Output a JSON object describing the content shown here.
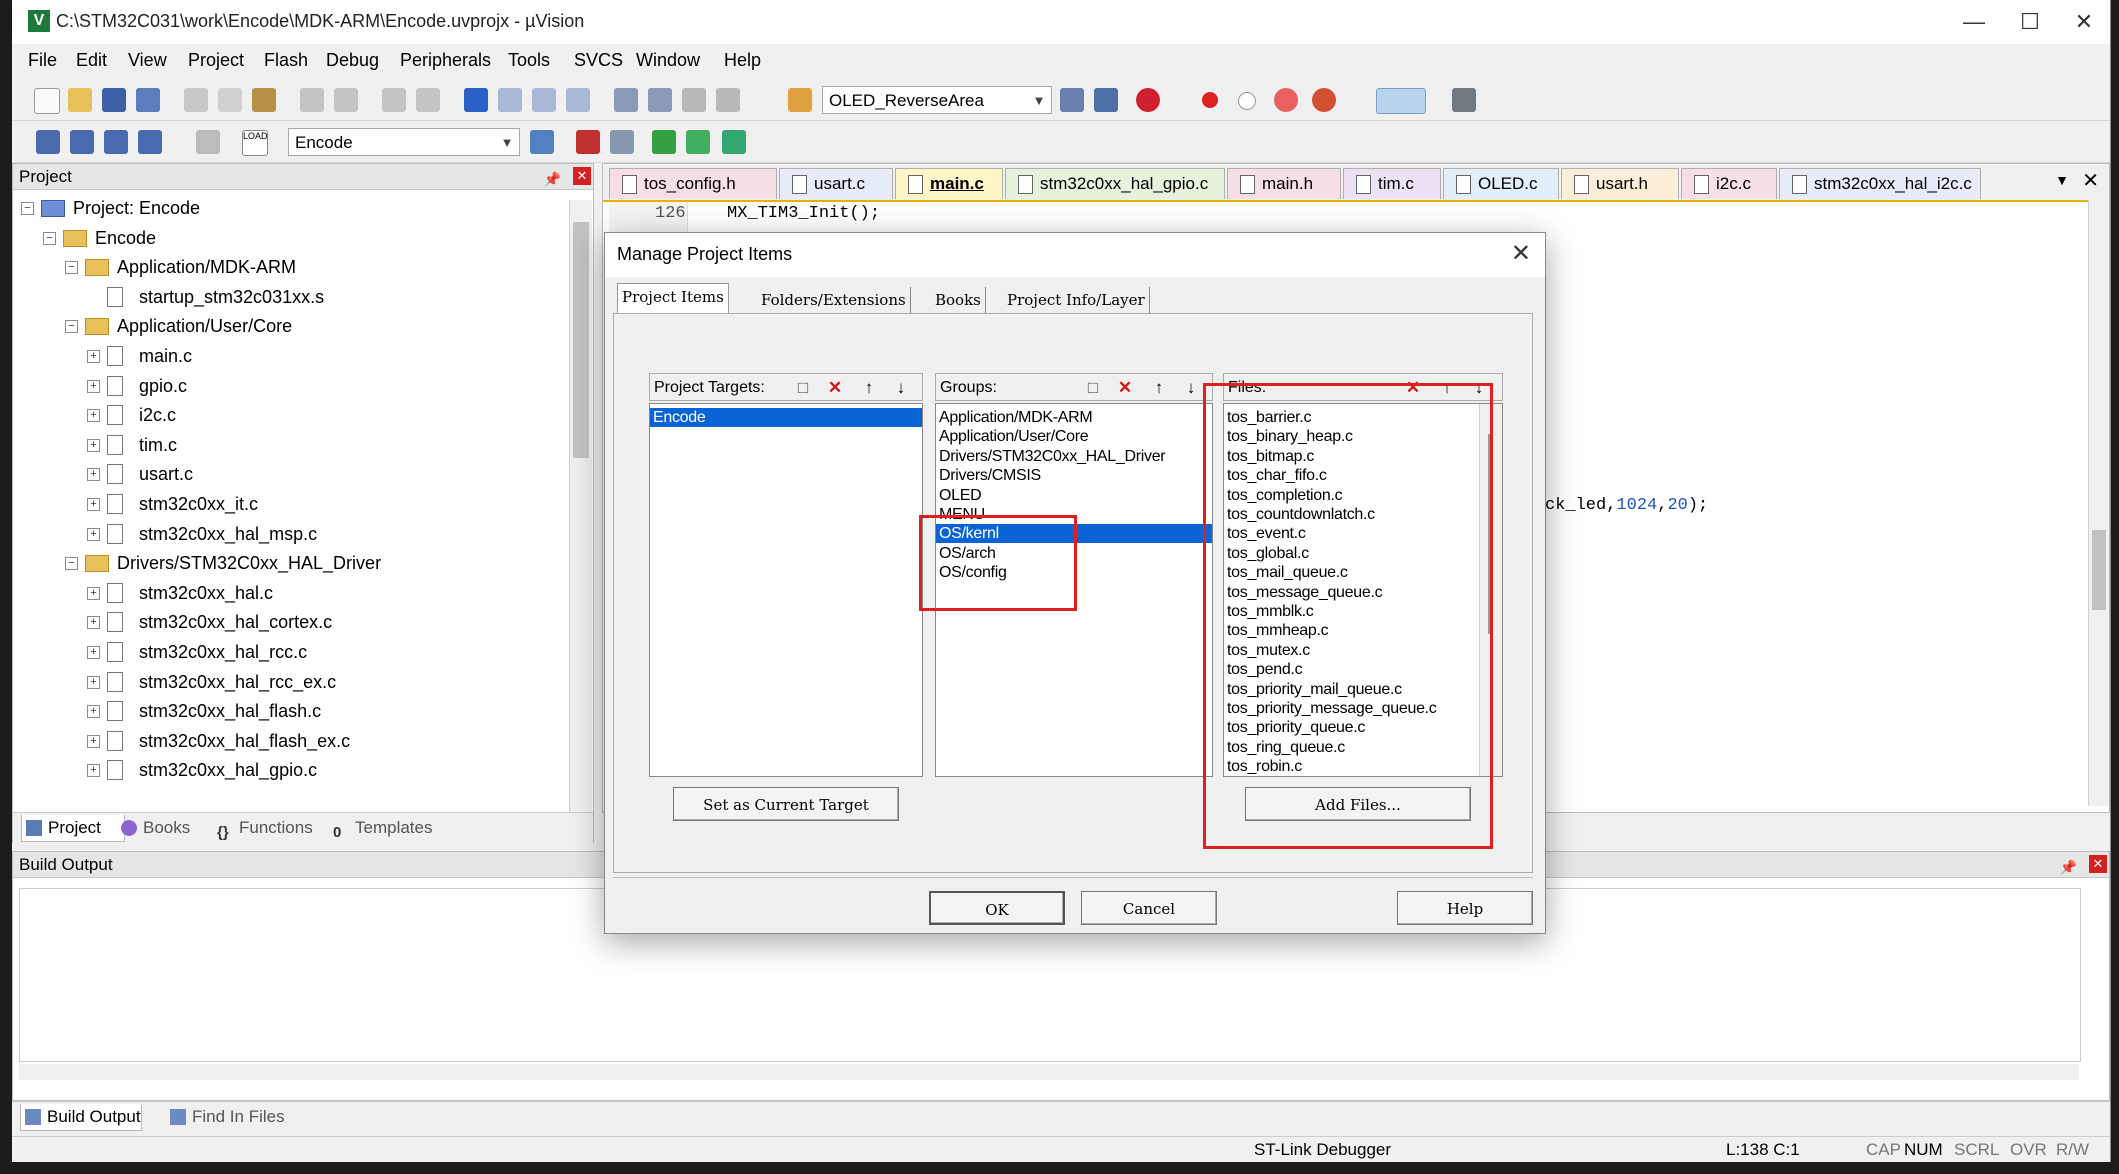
{
  "window": {
    "title": "C:\\STM32C031\\work\\Encode\\MDK-ARM\\Encode.uvprojx - µVision",
    "app_icon": "V"
  },
  "menu": [
    "File",
    "Edit",
    "View",
    "Project",
    "Flash",
    "Debug",
    "Peripherals",
    "Tools",
    "SVCS",
    "Window",
    "Help"
  ],
  "toolbar": {
    "search_combo": "OLED_ReverseArea",
    "target_combo": "Encode",
    "load_label": "LOAD"
  },
  "project_pane": {
    "title": "Project",
    "tree": [
      {
        "label": "Project: Encode",
        "level": 0,
        "kind": "project",
        "exp": "−"
      },
      {
        "label": "Encode",
        "level": 1,
        "kind": "target",
        "exp": "−"
      },
      {
        "label": "Application/MDK-ARM",
        "level": 2,
        "kind": "folder",
        "exp": "−"
      },
      {
        "label": "startup_stm32c031xx.s",
        "level": 3,
        "kind": "file",
        "exp": ""
      },
      {
        "label": "Application/User/Core",
        "level": 2,
        "kind": "folder",
        "exp": "−"
      },
      {
        "label": "main.c",
        "level": 3,
        "kind": "file",
        "exp": "+"
      },
      {
        "label": "gpio.c",
        "level": 3,
        "kind": "file",
        "exp": "+"
      },
      {
        "label": "i2c.c",
        "level": 3,
        "kind": "file",
        "exp": "+"
      },
      {
        "label": "tim.c",
        "level": 3,
        "kind": "file",
        "exp": "+"
      },
      {
        "label": "usart.c",
        "level": 3,
        "kind": "file",
        "exp": "+"
      },
      {
        "label": "stm32c0xx_it.c",
        "level": 3,
        "kind": "file",
        "exp": "+"
      },
      {
        "label": "stm32c0xx_hal_msp.c",
        "level": 3,
        "kind": "file",
        "exp": "+"
      },
      {
        "label": "Drivers/STM32C0xx_HAL_Driver",
        "level": 2,
        "kind": "folder",
        "exp": "−"
      },
      {
        "label": "stm32c0xx_hal.c",
        "level": 3,
        "kind": "file",
        "exp": "+"
      },
      {
        "label": "stm32c0xx_hal_cortex.c",
        "level": 3,
        "kind": "file",
        "exp": "+"
      },
      {
        "label": "stm32c0xx_hal_rcc.c",
        "level": 3,
        "kind": "file",
        "exp": "+"
      },
      {
        "label": "stm32c0xx_hal_rcc_ex.c",
        "level": 3,
        "kind": "file",
        "exp": "+"
      },
      {
        "label": "stm32c0xx_hal_flash.c",
        "level": 3,
        "kind": "file",
        "exp": "+"
      },
      {
        "label": "stm32c0xx_hal_flash_ex.c",
        "level": 3,
        "kind": "file",
        "exp": "+"
      },
      {
        "label": "stm32c0xx_hal_gpio.c",
        "level": 3,
        "kind": "file",
        "exp": "+"
      }
    ],
    "tabs": [
      "Project",
      "Books",
      "Functions",
      "Templates"
    ]
  },
  "editor": {
    "tabs": [
      {
        "label": "tos_config.h",
        "color": "#f6dfe6",
        "active": false
      },
      {
        "label": "usart.c",
        "color": "#e6ecf8",
        "active": false
      },
      {
        "label": "main.c",
        "color": "#fff6c8",
        "active": true
      },
      {
        "label": "stm32c0xx_hal_gpio.c",
        "color": "#e5f2dc",
        "active": false
      },
      {
        "label": "main.h",
        "color": "#f6dfe6",
        "active": false
      },
      {
        "label": "tim.c",
        "color": "#ece2f4",
        "active": false
      },
      {
        "label": "OLED.c",
        "color": "#e2eef8",
        "active": false
      },
      {
        "label": "usart.h",
        "color": "#fbeed8",
        "active": false
      },
      {
        "label": "i2c.c",
        "color": "#f6dfe6",
        "active": false
      },
      {
        "label": "stm32c0xx_hal_i2c.c",
        "color": "#e6ecf8",
        "active": false
      }
    ],
    "line_number": "126",
    "line_code": "MX_TIM3_Init();",
    "right_fragment_a": "ck_led,",
    "right_fragment_num1": "1024",
    "right_fragment_comma": ",",
    "right_fragment_num2": "20",
    "right_fragment_end": ");"
  },
  "build_output": {
    "title": "Build Output",
    "tabs": [
      "Build Output",
      "Find In Files"
    ]
  },
  "statusbar": {
    "debugger": "ST-Link Debugger",
    "position": "L:138 C:1",
    "caps": "CAP",
    "num": "NUM",
    "scrl": "SCRL",
    "ovr": "OVR",
    "rw": "R/W"
  },
  "dialog": {
    "title": "Manage Project Items",
    "tabs": [
      "Project Items",
      "Folders/Extensions",
      "Books",
      "Project Info/Layer"
    ],
    "targets_label": "Project Targets:",
    "targets": [
      "Encode"
    ],
    "groups_label": "Groups:",
    "groups": [
      "Application/MDK-ARM",
      "Application/User/Core",
      "Drivers/STM32C0xx_HAL_Driver",
      "Drivers/CMSIS",
      "OLED",
      "MENU",
      "OS/kernl",
      "OS/arch",
      "OS/config"
    ],
    "selected_group": "OS/kernl",
    "files_label": "Files:",
    "files": [
      "tos_barrier.c",
      "tos_binary_heap.c",
      "tos_bitmap.c",
      "tos_char_fifo.c",
      "tos_completion.c",
      "tos_countdownlatch.c",
      "tos_event.c",
      "tos_global.c",
      "tos_mail_queue.c",
      "tos_message_queue.c",
      "tos_mmblk.c",
      "tos_mmheap.c",
      "tos_mutex.c",
      "tos_pend.c",
      "tos_priority_mail_queue.c",
      "tos_priority_message_queue.c",
      "tos_priority_queue.c",
      "tos_ring_queue.c",
      "tos_robin.c"
    ],
    "set_target_button": "Set as Current Target",
    "add_files_button": "Add Files...",
    "ok_button": "OK",
    "cancel_button": "Cancel",
    "help_button": "Help"
  },
  "colors": {
    "selection": "#0a64d6",
    "highlight_box": "#e02020",
    "code_number": "#1a55c8"
  }
}
